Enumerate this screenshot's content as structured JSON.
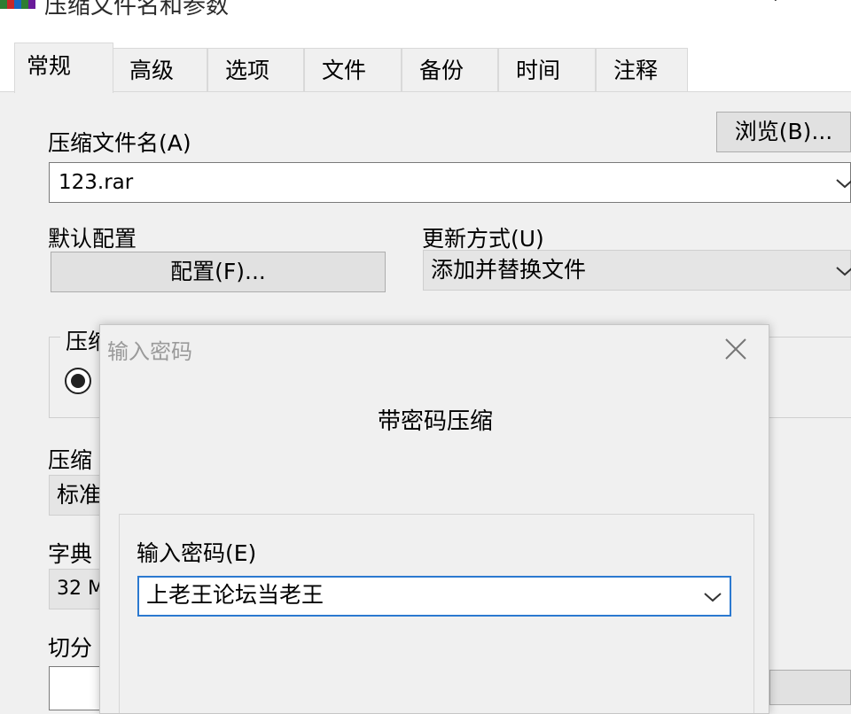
{
  "window": {
    "title": "压缩文件名和参数"
  },
  "tabs": [
    {
      "label": "常规",
      "active": true
    },
    {
      "label": "高级"
    },
    {
      "label": "选项"
    },
    {
      "label": "文件"
    },
    {
      "label": "备份"
    },
    {
      "label": "时间"
    },
    {
      "label": "注释"
    }
  ],
  "general": {
    "archive_name_label": "压缩文件名(A)",
    "browse_button": "浏览(B)...",
    "archive_name_value": "123.rar",
    "default_profile_label": "默认配置",
    "profile_button": "配置(F)...",
    "update_mode_label": "更新方式(U)",
    "update_mode_value": "添加并替换文件",
    "format_group_title": "压缩",
    "method_label": "压缩",
    "method_value": "标准",
    "dictionary_label": "字典",
    "dictionary_value": "32 M",
    "split_label": "切分"
  },
  "password_dialog": {
    "title": "输入密码",
    "heading": "带密码压缩",
    "password_label": "输入密码(E)",
    "password_value": "上老王论坛当老王"
  },
  "colors": {
    "focus_border": "#2b79d0",
    "window_bg": "#f0f0f0",
    "button_bg": "#e1e1e1"
  },
  "icons": {
    "app": "winrar-books-icon",
    "dropdown": "chevron-down-icon",
    "close": "close-icon"
  }
}
